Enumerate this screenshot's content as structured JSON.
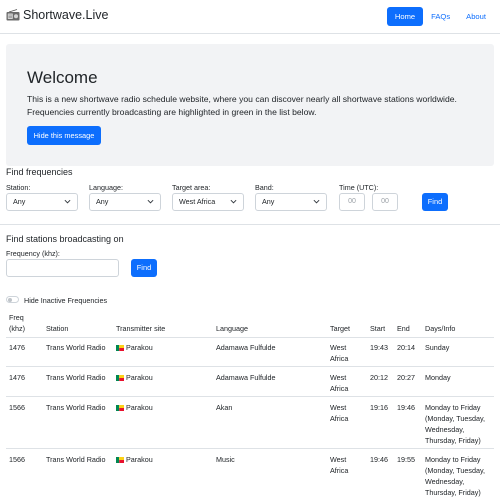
{
  "nav": {
    "brand": "Shortwave.Live",
    "links": [
      "Home",
      "FAQs",
      "About"
    ]
  },
  "hero": {
    "title": "Welcome",
    "text": "This is a new shortwave radio schedule website, where you can discover nearly all shortwave stations worldwide. Frequencies currently broadcasting are highlighted in green in the list below.",
    "button": "Hide this message"
  },
  "find_frequencies": {
    "title": "Find frequencies",
    "station_label": "Station:",
    "station_value": "Any",
    "language_label": "Language:",
    "language_value": "Any",
    "target_label": "Target area:",
    "target_value": "West Africa",
    "band_label": "Band:",
    "band_value": "Any",
    "time_label": "Time (UTC):",
    "time_start_placeholder": "00",
    "time_end_placeholder": "00",
    "button": "Find"
  },
  "find_stations": {
    "title": "Find stations broadcasting on",
    "freq_label": "Frequency (khz):",
    "button": "Find"
  },
  "toggle_label": "Hide Inactive Frequencies",
  "table": {
    "headers": {
      "freq_line1": "Freq",
      "freq_line2": "(khz)",
      "station": "Station",
      "site": "Transmitter site",
      "language": "Language",
      "target": "Target",
      "start": "Start",
      "end": "End",
      "days": "Days/Info"
    },
    "rows": [
      {
        "freq": "1476",
        "station": "Trans World Radio",
        "site": "Parakou",
        "language": "Adamawa Fulfulde",
        "target_1": "West",
        "target_2": "Africa",
        "start": "19:43",
        "end": "20:14",
        "days": [
          "Sunday"
        ]
      },
      {
        "freq": "1476",
        "station": "Trans World Radio",
        "site": "Parakou",
        "language": "Adamawa Fulfulde",
        "target_1": "West",
        "target_2": "Africa",
        "start": "20:12",
        "end": "20:27",
        "days": [
          "Monday"
        ]
      },
      {
        "freq": "1566",
        "station": "Trans World Radio",
        "site": "Parakou",
        "language": "Akan",
        "target_1": "West",
        "target_2": "Africa",
        "start": "19:16",
        "end": "19:46",
        "days": [
          "Monday to Friday",
          "(Monday, Tuesday,",
          "Wednesday,",
          "Thursday, Friday)"
        ]
      },
      {
        "freq": "1566",
        "station": "Trans World Radio",
        "site": "Parakou",
        "language": "Music",
        "target_1": "West",
        "target_2": "Africa",
        "start": "19:46",
        "end": "19:55",
        "days": [
          "Monday to Friday",
          "(Monday, Tuesday,",
          "Wednesday,",
          "Thursday, Friday)"
        ]
      }
    ]
  },
  "colors": {
    "primary": "#0d6efd",
    "hero_bg": "#f2f3f5",
    "border": "#dee2e6"
  }
}
